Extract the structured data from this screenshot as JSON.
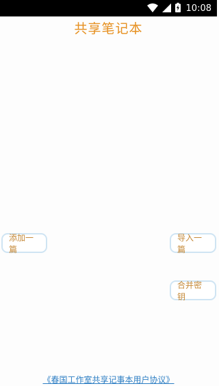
{
  "status_bar": {
    "time": "10:08",
    "icons": [
      "wifi-icon",
      "signal-icon",
      "battery-charging-icon"
    ]
  },
  "header": {
    "title": "共享笔记本"
  },
  "buttons": {
    "add_label": "添加一篇",
    "import_label": "导入一篇",
    "merge_key_label": "合并密钥"
  },
  "footer": {
    "agreement_link": "《春国工作室共享记事本用户协议》"
  },
  "colors": {
    "title": "#e69020",
    "button_text": "#c58a3a",
    "button_border": "#cfe4f3",
    "link": "#2e7fc4"
  }
}
